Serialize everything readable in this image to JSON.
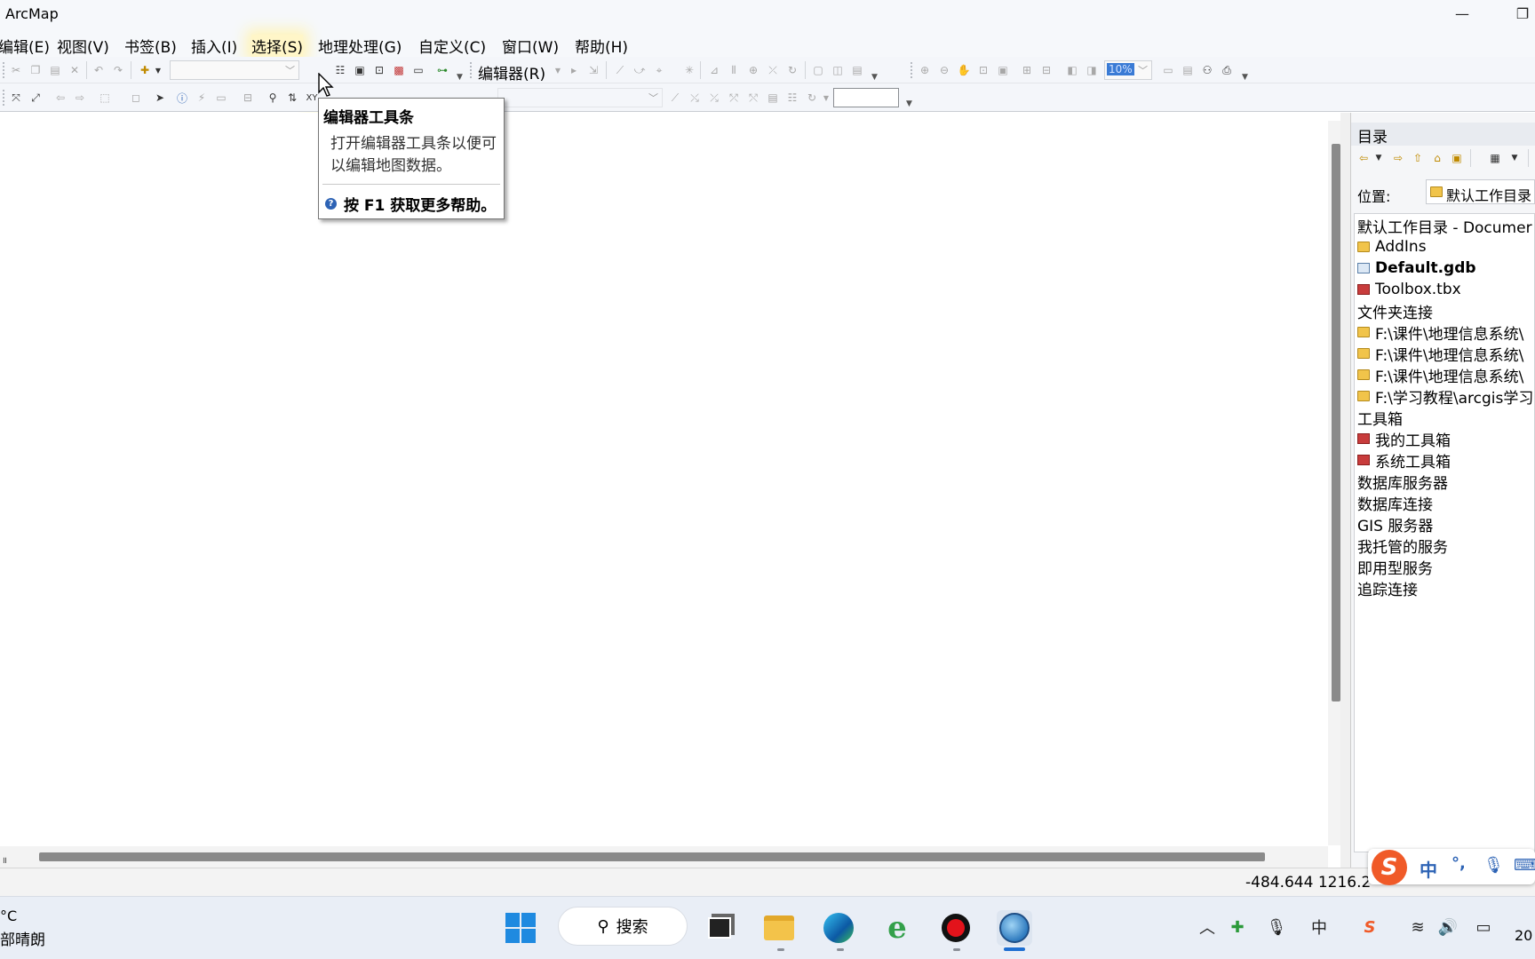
{
  "window": {
    "title": "ArcMap"
  },
  "menu": [
    {
      "label": "编辑(E)"
    },
    {
      "label": "视图(V)"
    },
    {
      "label": "书签(B)"
    },
    {
      "label": "插入(I)"
    },
    {
      "label": "选择(S)"
    },
    {
      "label": "地理处理(G)"
    },
    {
      "label": "自定义(C)"
    },
    {
      "label": "窗口(W)"
    },
    {
      "label": "帮助(H)"
    }
  ],
  "toolbar": {
    "editor_label": "编辑器(R)",
    "zoom_value": "10%"
  },
  "tooltip": {
    "title": "编辑器工具条",
    "body": "打开编辑器工具条以便可以编辑地图数据。",
    "help": "按 F1 获取更多帮助。"
  },
  "catalog": {
    "title": "目录",
    "location_label": "位置:",
    "location_value": "默认工作目录",
    "tree": [
      {
        "label": "默认工作目录 - Documer",
        "icon": "none"
      },
      {
        "label": "AddIns",
        "icon": "folder-icon"
      },
      {
        "label": "Default.gdb",
        "icon": "geodatabase-icon"
      },
      {
        "label": "Toolbox.tbx",
        "icon": "toolbox-icon"
      },
      {
        "label": "文件夹连接",
        "icon": "none"
      },
      {
        "label": "F:\\课件\\地理信息系统\\",
        "icon": "folder-icon"
      },
      {
        "label": "F:\\课件\\地理信息系统\\",
        "icon": "folder-icon"
      },
      {
        "label": "F:\\课件\\地理信息系统\\",
        "icon": "folder-icon"
      },
      {
        "label": "F:\\学习教程\\arcgis学习",
        "icon": "folder-icon"
      },
      {
        "label": "工具箱",
        "icon": "none"
      },
      {
        "label": "我的工具箱",
        "icon": "toolbox-icon"
      },
      {
        "label": "系统工具箱",
        "icon": "toolbox-icon"
      },
      {
        "label": "数据库服务器",
        "icon": "none"
      },
      {
        "label": "数据库连接",
        "icon": "none"
      },
      {
        "label": "GIS 服务器",
        "icon": "none"
      },
      {
        "label": "我托管的服务",
        "icon": "none"
      },
      {
        "label": "即用型服务",
        "icon": "none"
      },
      {
        "label": "追踪连接",
        "icon": "none"
      }
    ]
  },
  "status": {
    "coords": "-484.644  1216.2"
  },
  "ime": {
    "mode": "中",
    "punct": "°,"
  },
  "taskbar": {
    "weather_temp": "°C",
    "weather_desc": "部晴朗",
    "search_label": "搜索",
    "clock": "20",
    "tray_ime": "中"
  }
}
